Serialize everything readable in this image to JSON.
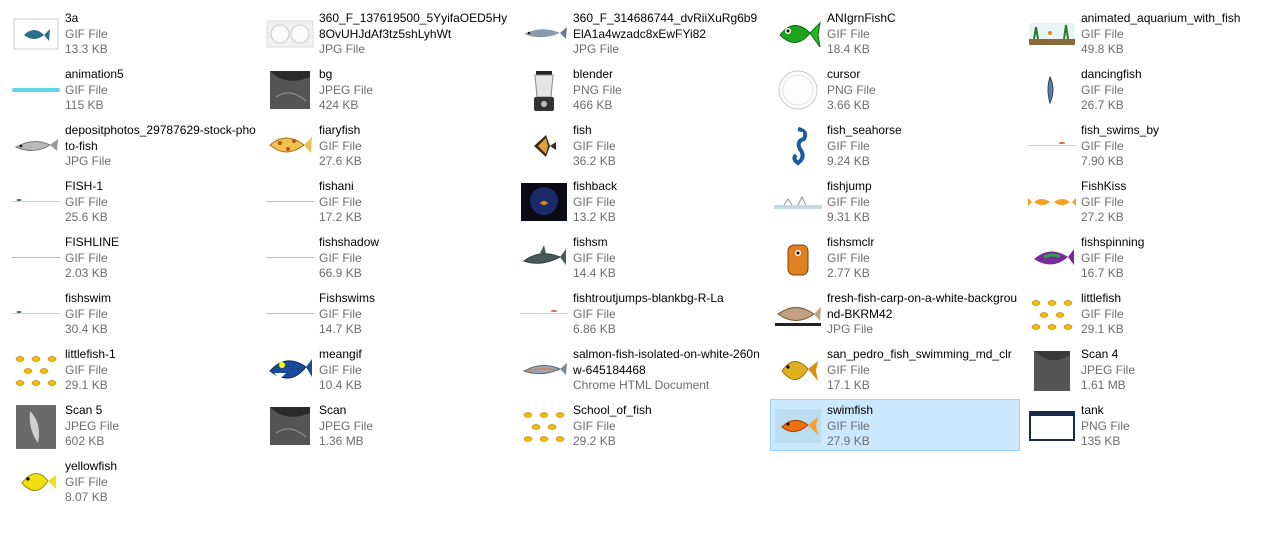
{
  "files": [
    {
      "name": "3a",
      "type": "GIF File",
      "size": "13.3 KB",
      "icon": "small-fish-thumbnail"
    },
    {
      "name": "360_F_137619500_5YyifaOED5Hy8OvUHJdAf3tz5shLyhWt",
      "type": "JPG File",
      "size": "",
      "icon": "plates-thumbnail"
    },
    {
      "name": "360_F_314686744_dvRiiXuRg6b9ElA1a4wzadc8xEwFYi82",
      "type": "JPG File",
      "size": "",
      "icon": "fish-photo-thumbnail"
    },
    {
      "name": "ANIgrnFishC",
      "type": "GIF File",
      "size": "18.4 KB",
      "icon": "green-fish-thumbnail"
    },
    {
      "name": "animated_aquarium_with_fish",
      "type": "GIF File",
      "size": "49.8 KB",
      "icon": "aquarium-thumbnail"
    },
    {
      "name": "animation5",
      "type": "GIF File",
      "size": "115 KB",
      "icon": "cyan-line-thumbnail"
    },
    {
      "name": "bg",
      "type": "JPEG File",
      "size": "424 KB",
      "icon": "dark-texture-thumbnail"
    },
    {
      "name": "blender",
      "type": "PNG File",
      "size": "466 KB",
      "icon": "blender-thumbnail"
    },
    {
      "name": "cursor",
      "type": "PNG File",
      "size": "3.66 KB",
      "icon": "bowl-thumbnail"
    },
    {
      "name": "dancingfish",
      "type": "GIF File",
      "size": "26.7 KB",
      "icon": "thin-fish-thumbnail"
    },
    {
      "name": "depositphotos_29787629-stock-photo-fish",
      "type": "JPG File",
      "size": "",
      "icon": "silver-fish-thumbnail"
    },
    {
      "name": "fiaryfish",
      "type": "GIF File",
      "size": "27.6 KB",
      "icon": "spotted-fish-thumbnail"
    },
    {
      "name": "fish",
      "type": "GIF File",
      "size": "36.2 KB",
      "icon": "angelfish-thumbnail"
    },
    {
      "name": "fish_seahorse",
      "type": "GIF File",
      "size": "9.24 KB",
      "icon": "seahorse-thumbnail"
    },
    {
      "name": "fish_swims_by",
      "type": "GIF File",
      "size": "7.90 KB",
      "icon": "tiny-fish-thumbnail"
    },
    {
      "name": "FISH-1",
      "type": "GIF File",
      "size": "25.6 KB",
      "icon": "tiny-blue-fish-thumbnail"
    },
    {
      "name": "fishani",
      "type": "GIF File",
      "size": "17.2 KB",
      "icon": "line-thumbnail"
    },
    {
      "name": "fishback",
      "type": "GIF File",
      "size": "13.2 KB",
      "icon": "fishbowl-dark-thumbnail"
    },
    {
      "name": "fishjump",
      "type": "GIF File",
      "size": "9.31 KB",
      "icon": "water-splash-thumbnail"
    },
    {
      "name": "FishKiss",
      "type": "GIF File",
      "size": "27.2 KB",
      "icon": "kissing-fish-thumbnail"
    },
    {
      "name": "FISHLINE",
      "type": "GIF File",
      "size": "2.03 KB",
      "icon": "line-thumbnail"
    },
    {
      "name": "fishshadow",
      "type": "GIF File",
      "size": "66.9 KB",
      "icon": "line-thumbnail"
    },
    {
      "name": "fishsm",
      "type": "GIF File",
      "size": "14.4 KB",
      "icon": "shark-thumbnail"
    },
    {
      "name": "fishsmclr",
      "type": "GIF File",
      "size": "2.77 KB",
      "icon": "orange-fish-thumbnail"
    },
    {
      "name": "fishspinning",
      "type": "GIF File",
      "size": "16.7 KB",
      "icon": "purple-fish-thumbnail"
    },
    {
      "name": "fishswim",
      "type": "GIF File",
      "size": "30.4 KB",
      "icon": "tiny-blue-fish-thumbnail"
    },
    {
      "name": "Fishswims",
      "type": "GIF File",
      "size": "14.7 KB",
      "icon": "line-thumbnail"
    },
    {
      "name": "fishtroutjumps-blankbg-R-La",
      "type": "GIF File",
      "size": "6.86 KB",
      "icon": "tiny-fish-thumbnail"
    },
    {
      "name": "fresh-fish-carp-on-a-white-background-BKRM42",
      "type": "JPG File",
      "size": "",
      "icon": "carp-thumbnail"
    },
    {
      "name": "littlefish",
      "type": "GIF File",
      "size": "29.1 KB",
      "icon": "fish-school-thumbnail"
    },
    {
      "name": "littlefish-1",
      "type": "GIF File",
      "size": "29.1 KB",
      "icon": "fish-school-thumbnail"
    },
    {
      "name": "meangif",
      "type": "GIF File",
      "size": "10.4 KB",
      "icon": "mean-fish-thumbnail"
    },
    {
      "name": "salmon-fish-isolated-on-white-260nw-645184468",
      "type": "Chrome HTML Document",
      "size": "",
      "icon": "salmon-thumbnail"
    },
    {
      "name": "san_pedro_fish_swimming_md_clr",
      "type": "GIF File",
      "size": "17.1 KB",
      "icon": "yellow-fish-thumbnail"
    },
    {
      "name": "Scan 4",
      "type": "JPEG File",
      "size": "1.61 MB",
      "icon": "dark-scan-thumbnail"
    },
    {
      "name": "Scan 5",
      "type": "JPEG File",
      "size": "602 KB",
      "icon": "gray-scan-thumbnail"
    },
    {
      "name": "Scan",
      "type": "JPEG File",
      "size": "1.36 MB",
      "icon": "dark-texture-thumbnail"
    },
    {
      "name": "School_of_fish",
      "type": "GIF File",
      "size": "29.2 KB",
      "icon": "fish-school-thumbnail"
    },
    {
      "name": "swimfish",
      "type": "GIF File",
      "size": "27.9 KB",
      "icon": "goldfish-thumbnail",
      "selected": true
    },
    {
      "name": "tank",
      "type": "PNG File",
      "size": "135 KB",
      "icon": "tank-thumbnail"
    },
    {
      "name": "yellowfish",
      "type": "GIF File",
      "size": "8.07 KB",
      "icon": "yellow-tang-thumbnail"
    }
  ],
  "colors": {
    "selection_bg": "#cce8ff",
    "selection_border": "#99d1ff",
    "secondary_text": "#6d6d6d"
  }
}
